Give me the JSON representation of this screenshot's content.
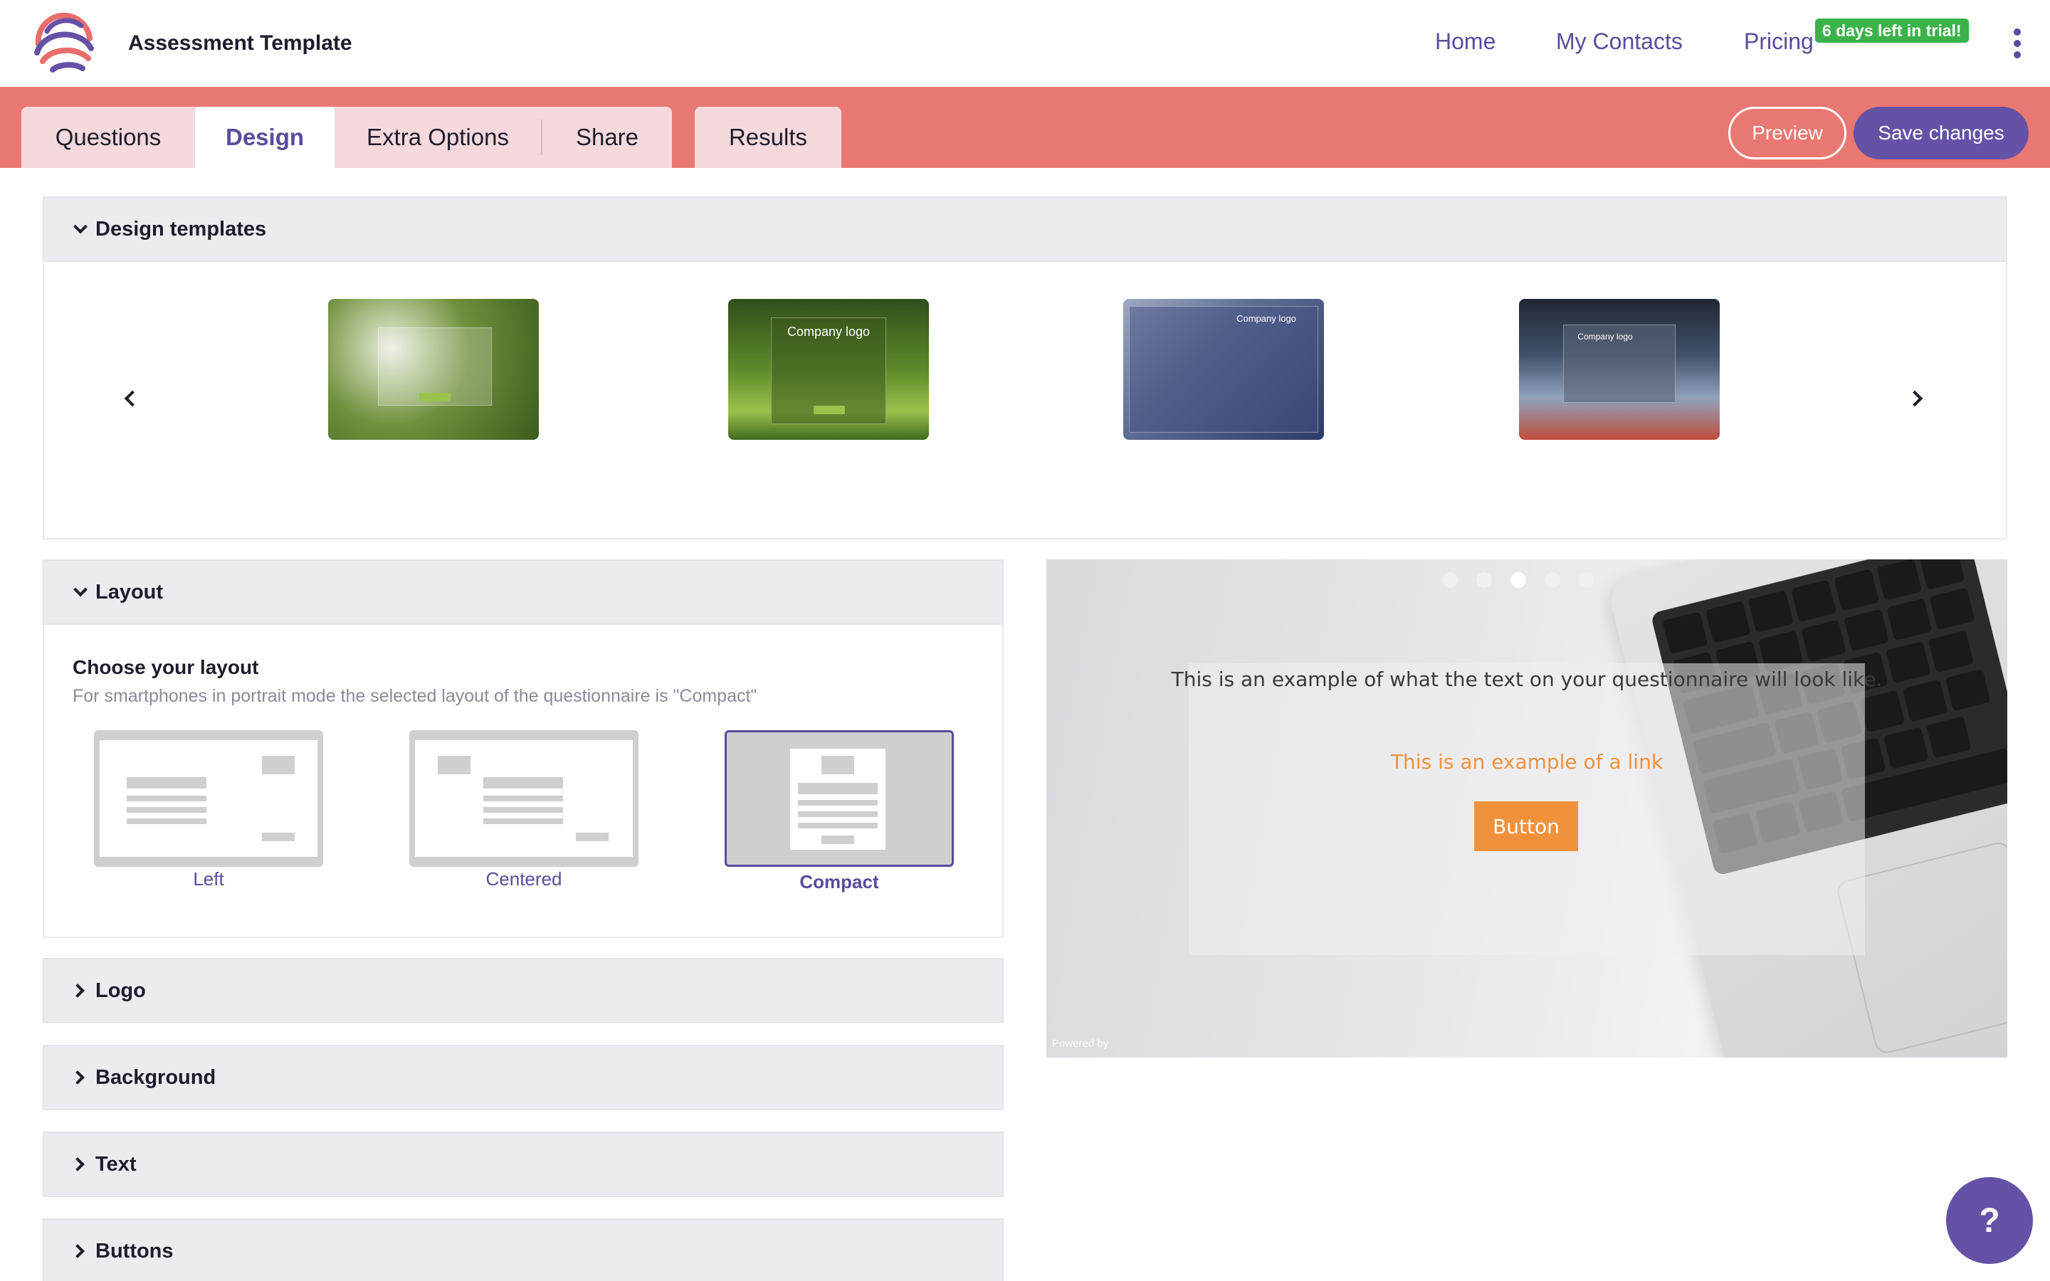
{
  "header": {
    "title": "Assessment Template",
    "nav": {
      "home": "Home",
      "contacts": "My Contacts",
      "pricing": "Pricing"
    },
    "trial_badge": "6 days left in trial!",
    "colors": {
      "accent": "#5b4a9e",
      "trial_badge": "#3bb34a"
    }
  },
  "tabs": {
    "questions": "Questions",
    "design": "Design",
    "extra_options": "Extra Options",
    "share": "Share",
    "results": "Results",
    "active": "Design",
    "strip_color": "#ea7872"
  },
  "actions": {
    "preview": "Preview",
    "save": "Save changes",
    "save_color": "#6552a6"
  },
  "design_templates": {
    "heading": "Design templates",
    "thumbnails": [
      {
        "icon": "template-dandelion-thumbnail"
      },
      {
        "icon": "template-forest-thumbnail",
        "logo_text": "Company logo"
      },
      {
        "icon": "template-handshake-thumbnail",
        "logo_text": "Company logo"
      },
      {
        "icon": "template-skyscraper-thumbnail",
        "logo_text": "Company logo"
      }
    ]
  },
  "layout": {
    "heading": "Layout",
    "choose_title": "Choose your layout",
    "note": "For smartphones in portrait mode the selected layout of the questionnaire is \"Compact\"",
    "options": {
      "left": "Left",
      "centered": "Centered",
      "compact": "Compact"
    },
    "selected": "Compact"
  },
  "sections": {
    "logo": "Logo",
    "background": "Background",
    "text": "Text",
    "buttons": "Buttons"
  },
  "preview": {
    "body_text": "This is an example of what the text on your questionnaire will look like.",
    "link_text": "This is an example of a link",
    "button_text": "Button",
    "powered_by": "Powered by",
    "button_color": "#f0923c",
    "active_dot": 3,
    "dot_count": 5
  },
  "help": {
    "label": "?"
  }
}
